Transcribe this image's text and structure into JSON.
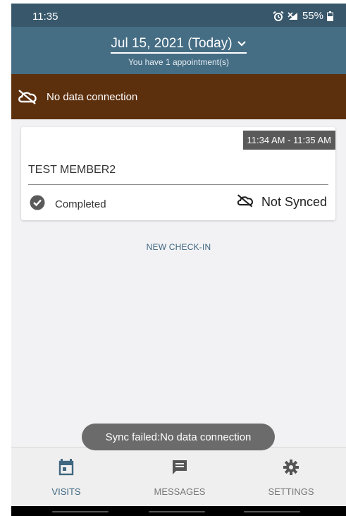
{
  "status_bar": {
    "time": "11:35",
    "battery": "55%"
  },
  "header": {
    "date": "Jul 15, 2021 (Today)",
    "subtitle": "You have 1 appointment(s)"
  },
  "banner": {
    "text": "No data connection",
    "color": "#5c2f0d"
  },
  "appointment": {
    "time_range": "11:34 AM - 11:35 AM",
    "member": "TEST MEMBER2",
    "status": "Completed",
    "sync_status": "Not Synced"
  },
  "new_checkin_label": "NEW CHECK-IN",
  "toast": "Sync failed:No data connection",
  "bottom_nav": {
    "items": [
      {
        "label": "VISITS",
        "icon": "calendar-icon",
        "active": true
      },
      {
        "label": "MESSAGES",
        "icon": "message-icon",
        "active": false
      },
      {
        "label": "SETTINGS",
        "icon": "gear-icon",
        "active": false
      }
    ]
  },
  "colors": {
    "header": "#456d84",
    "status_bar": "#38576b",
    "accent": "#3f6780"
  }
}
